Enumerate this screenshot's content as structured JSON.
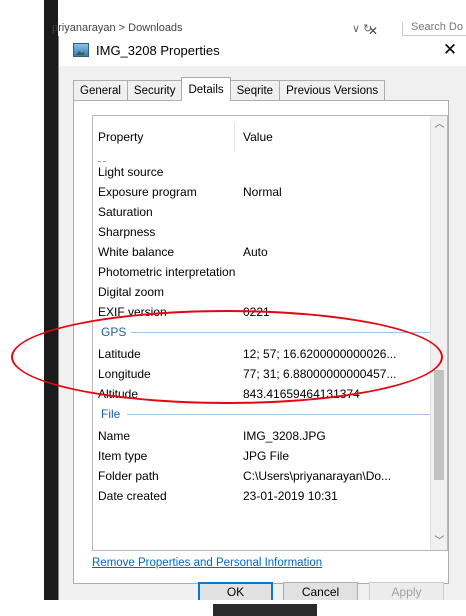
{
  "background": {
    "breadcrumb": "priyanarayan  >  Downloads",
    "refresh_label": "∨  ↻",
    "search_placeholder": "Search Do"
  },
  "dialog": {
    "title": "IMG_3208 Properties",
    "tabs": [
      {
        "label": "General",
        "active": false
      },
      {
        "label": "Security",
        "active": false
      },
      {
        "label": "Details",
        "active": true
      },
      {
        "label": "Seqrite",
        "active": false
      },
      {
        "label": "Previous Versions",
        "active": false
      }
    ],
    "columns": {
      "property": "Property",
      "value": "Value"
    },
    "rows": {
      "light_source": {
        "k": "Light source",
        "v": ""
      },
      "exposure_program": {
        "k": "Exposure program",
        "v": "Normal"
      },
      "saturation": {
        "k": "Saturation",
        "v": ""
      },
      "sharpness": {
        "k": "Sharpness",
        "v": ""
      },
      "white_balance": {
        "k": "White balance",
        "v": "Auto"
      },
      "photometric": {
        "k": "Photometric interpretation",
        "v": ""
      },
      "digital_zoom": {
        "k": "Digital zoom",
        "v": ""
      },
      "exif_version": {
        "k": "EXIF version",
        "v": "0221"
      },
      "latitude": {
        "k": "Latitude",
        "v": "12; 57; 16.6200000000026..."
      },
      "longitude": {
        "k": "Longitude",
        "v": "77; 31; 6.88000000000457..."
      },
      "altitude": {
        "k": "Altitude",
        "v": "843.41659464131374"
      },
      "name": {
        "k": "Name",
        "v": "IMG_3208.JPG"
      },
      "item_type": {
        "k": "Item type",
        "v": "JPG File"
      },
      "folder_path": {
        "k": "Folder path",
        "v": "C:\\Users\\priyanarayan\\Do..."
      },
      "date_created": {
        "k": "Date created",
        "v": "23-01-2019 10:31"
      }
    },
    "groups": {
      "gps": "GPS",
      "file": "File"
    },
    "remove_link": "Remove Properties and Personal Information",
    "buttons": {
      "ok": "OK",
      "cancel": "Cancel",
      "apply": "Apply"
    }
  },
  "colors": {
    "annotation": "#e30613",
    "link": "#0066cc",
    "group_header": "#1f5fa8"
  }
}
